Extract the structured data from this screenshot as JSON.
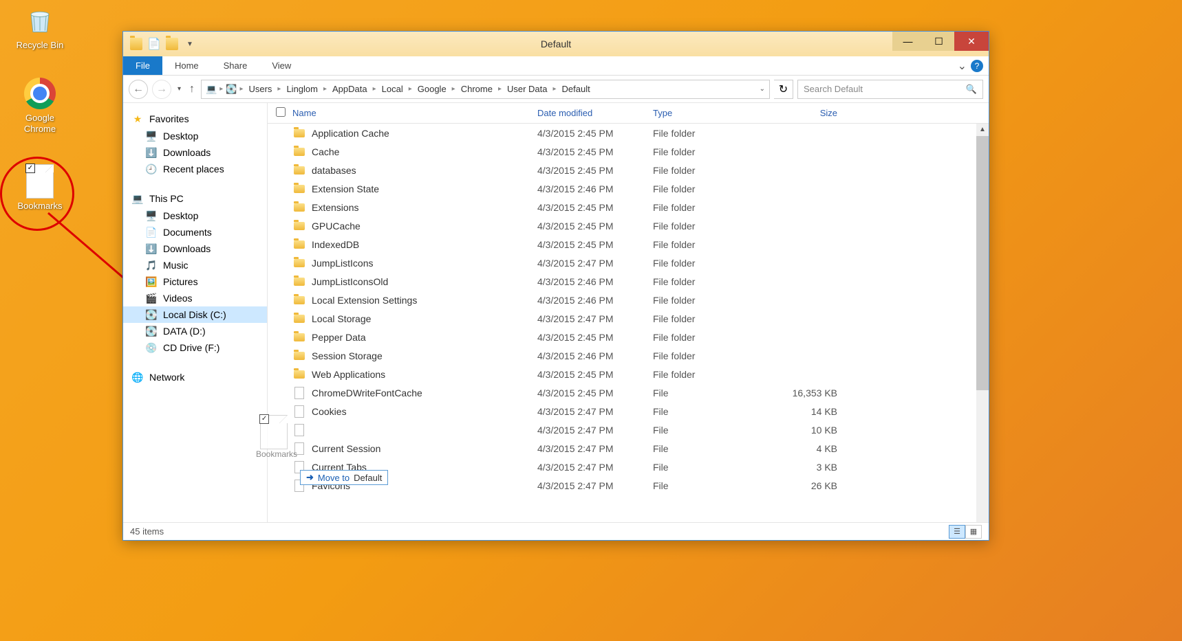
{
  "desktop": {
    "recycle": "Recycle Bin",
    "chrome": "Google Chrome",
    "bookmarks": "Bookmarks"
  },
  "window": {
    "title": "Default",
    "tabs": {
      "file": "File",
      "home": "Home",
      "share": "Share",
      "view": "View"
    }
  },
  "breadcrumb": [
    "Users",
    "Linglom",
    "AppData",
    "Local",
    "Google",
    "Chrome",
    "User Data",
    "Default"
  ],
  "search": {
    "placeholder": "Search Default"
  },
  "nav": {
    "favorites": "Favorites",
    "fav_items": [
      "Desktop",
      "Downloads",
      "Recent places"
    ],
    "thispc": "This PC",
    "pc_items": [
      "Desktop",
      "Documents",
      "Downloads",
      "Music",
      "Pictures",
      "Videos",
      "Local Disk (C:)",
      "DATA (D:)",
      "CD Drive (F:)"
    ],
    "network": "Network"
  },
  "columns": {
    "name": "Name",
    "date": "Date modified",
    "type": "Type",
    "size": "Size"
  },
  "files": [
    {
      "icon": "folder",
      "name": "Application Cache",
      "date": "4/3/2015 2:45 PM",
      "type": "File folder",
      "size": ""
    },
    {
      "icon": "folder",
      "name": "Cache",
      "date": "4/3/2015 2:45 PM",
      "type": "File folder",
      "size": ""
    },
    {
      "icon": "folder",
      "name": "databases",
      "date": "4/3/2015 2:45 PM",
      "type": "File folder",
      "size": ""
    },
    {
      "icon": "folder",
      "name": "Extension State",
      "date": "4/3/2015 2:46 PM",
      "type": "File folder",
      "size": ""
    },
    {
      "icon": "folder",
      "name": "Extensions",
      "date": "4/3/2015 2:45 PM",
      "type": "File folder",
      "size": ""
    },
    {
      "icon": "folder",
      "name": "GPUCache",
      "date": "4/3/2015 2:45 PM",
      "type": "File folder",
      "size": ""
    },
    {
      "icon": "folder",
      "name": "IndexedDB",
      "date": "4/3/2015 2:45 PM",
      "type": "File folder",
      "size": ""
    },
    {
      "icon": "folder",
      "name": "JumpListIcons",
      "date": "4/3/2015 2:47 PM",
      "type": "File folder",
      "size": ""
    },
    {
      "icon": "folder",
      "name": "JumpListIconsOld",
      "date": "4/3/2015 2:46 PM",
      "type": "File folder",
      "size": ""
    },
    {
      "icon": "folder",
      "name": "Local Extension Settings",
      "date": "4/3/2015 2:46 PM",
      "type": "File folder",
      "size": ""
    },
    {
      "icon": "folder",
      "name": "Local Storage",
      "date": "4/3/2015 2:47 PM",
      "type": "File folder",
      "size": ""
    },
    {
      "icon": "folder",
      "name": "Pepper Data",
      "date": "4/3/2015 2:45 PM",
      "type": "File folder",
      "size": ""
    },
    {
      "icon": "folder",
      "name": "Session Storage",
      "date": "4/3/2015 2:46 PM",
      "type": "File folder",
      "size": ""
    },
    {
      "icon": "folder",
      "name": "Web Applications",
      "date": "4/3/2015 2:45 PM",
      "type": "File folder",
      "size": ""
    },
    {
      "icon": "file",
      "name": "ChromeDWriteFontCache",
      "date": "4/3/2015 2:45 PM",
      "type": "File",
      "size": "16,353 KB"
    },
    {
      "icon": "file",
      "name": "Cookies",
      "date": "4/3/2015 2:47 PM",
      "type": "File",
      "size": "14 KB"
    },
    {
      "icon": "file",
      "name": "",
      "date": "4/3/2015 2:47 PM",
      "type": "File",
      "size": "10 KB"
    },
    {
      "icon": "file",
      "name": "Current Session",
      "date": "4/3/2015 2:47 PM",
      "type": "File",
      "size": "4 KB"
    },
    {
      "icon": "file",
      "name": "Current Tabs",
      "date": "4/3/2015 2:47 PM",
      "type": "File",
      "size": "3 KB"
    },
    {
      "icon": "file",
      "name": "Favicons",
      "date": "4/3/2015 2:47 PM",
      "type": "File",
      "size": "26 KB"
    }
  ],
  "status": "45 items",
  "drag": {
    "label": "Bookmarks",
    "tip_action": "Move to",
    "tip_target": "Default"
  }
}
